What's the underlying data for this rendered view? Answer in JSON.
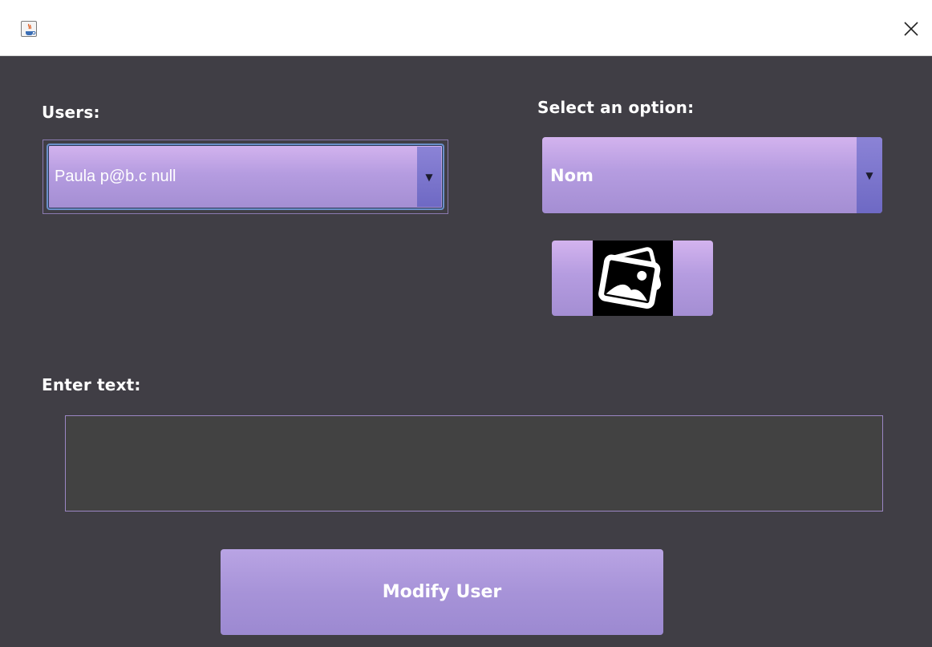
{
  "window": {
    "app_icon": "java-cup-icon",
    "close_icon": "close-icon"
  },
  "users": {
    "label": "Users:",
    "selected": "Paula p@b.c null"
  },
  "option": {
    "label": "Select an option:",
    "selected": "Nom"
  },
  "image_button": {
    "icon": "image-gallery-icon"
  },
  "text_entry": {
    "label": "Enter text:",
    "value": ""
  },
  "actions": {
    "modify_label": "Modify User"
  },
  "colors": {
    "background": "#403e45",
    "accent": "#b59ce0",
    "arrow": "#6e69c4",
    "text_area": "#424242"
  }
}
